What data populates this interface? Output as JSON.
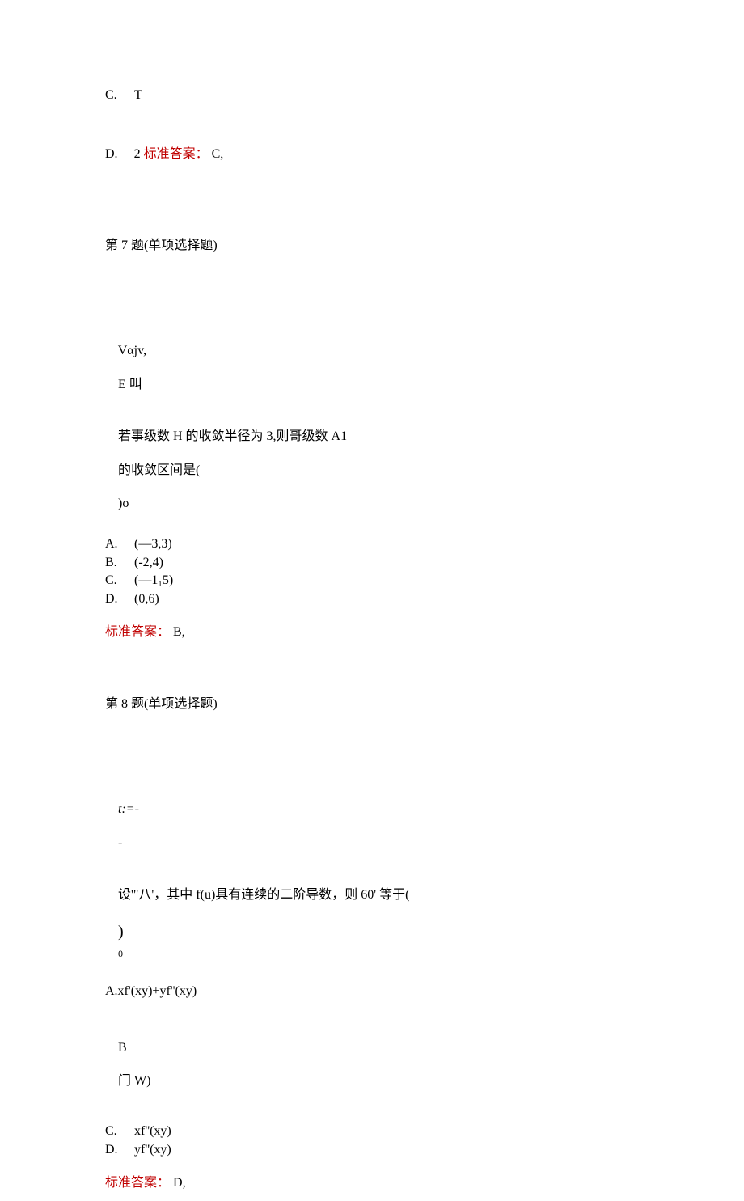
{
  "q6": {
    "optionC": {
      "letter": "C.",
      "text": "T"
    },
    "optionD": {
      "letter": "D.",
      "text": "2"
    },
    "answer_label": "标准答案：",
    "answer_value": "C,"
  },
  "q7": {
    "header": "第 7 题(单项选择题)",
    "frag1": "Vαjv,",
    "frag2": "E 叫",
    "stem_a": "若事级数 H 的收敛半径为 3,则哥级数 A1",
    "stem_b": "的收敛区间是(",
    "stem_c": ")o",
    "optionA": {
      "letter": "A.",
      "text": "(—3,3)"
    },
    "optionB": {
      "letter": "B.",
      "text": "(-2,4)"
    },
    "optionC": {
      "letter": "C.",
      "text": "(—1₁5)"
    },
    "optionD": {
      "letter": "D.",
      "text": "(0,6)"
    },
    "answer_label": "标准答案：",
    "answer_value": "B,"
  },
  "q8": {
    "header": "第 8 题(单项选择题)",
    "frag1": "t:=-",
    "frag2": "-",
    "stem_a": "设'\"八'，其中 f(u)具有连续的二阶导数，则 60' 等于(",
    "stem_b": ")",
    "stem_c": "0",
    "optionA_line": "A.xf'(xy)+yf''(xy)",
    "optionB": {
      "letter": "B",
      "text": "门 W)"
    },
    "optionC": {
      "letter": "C.",
      "text": "xf''(xy)"
    },
    "optionD": {
      "letter": "D.",
      "text": "yf''(xy)"
    },
    "answer_label": "标准答案：",
    "answer_value": "D,"
  }
}
